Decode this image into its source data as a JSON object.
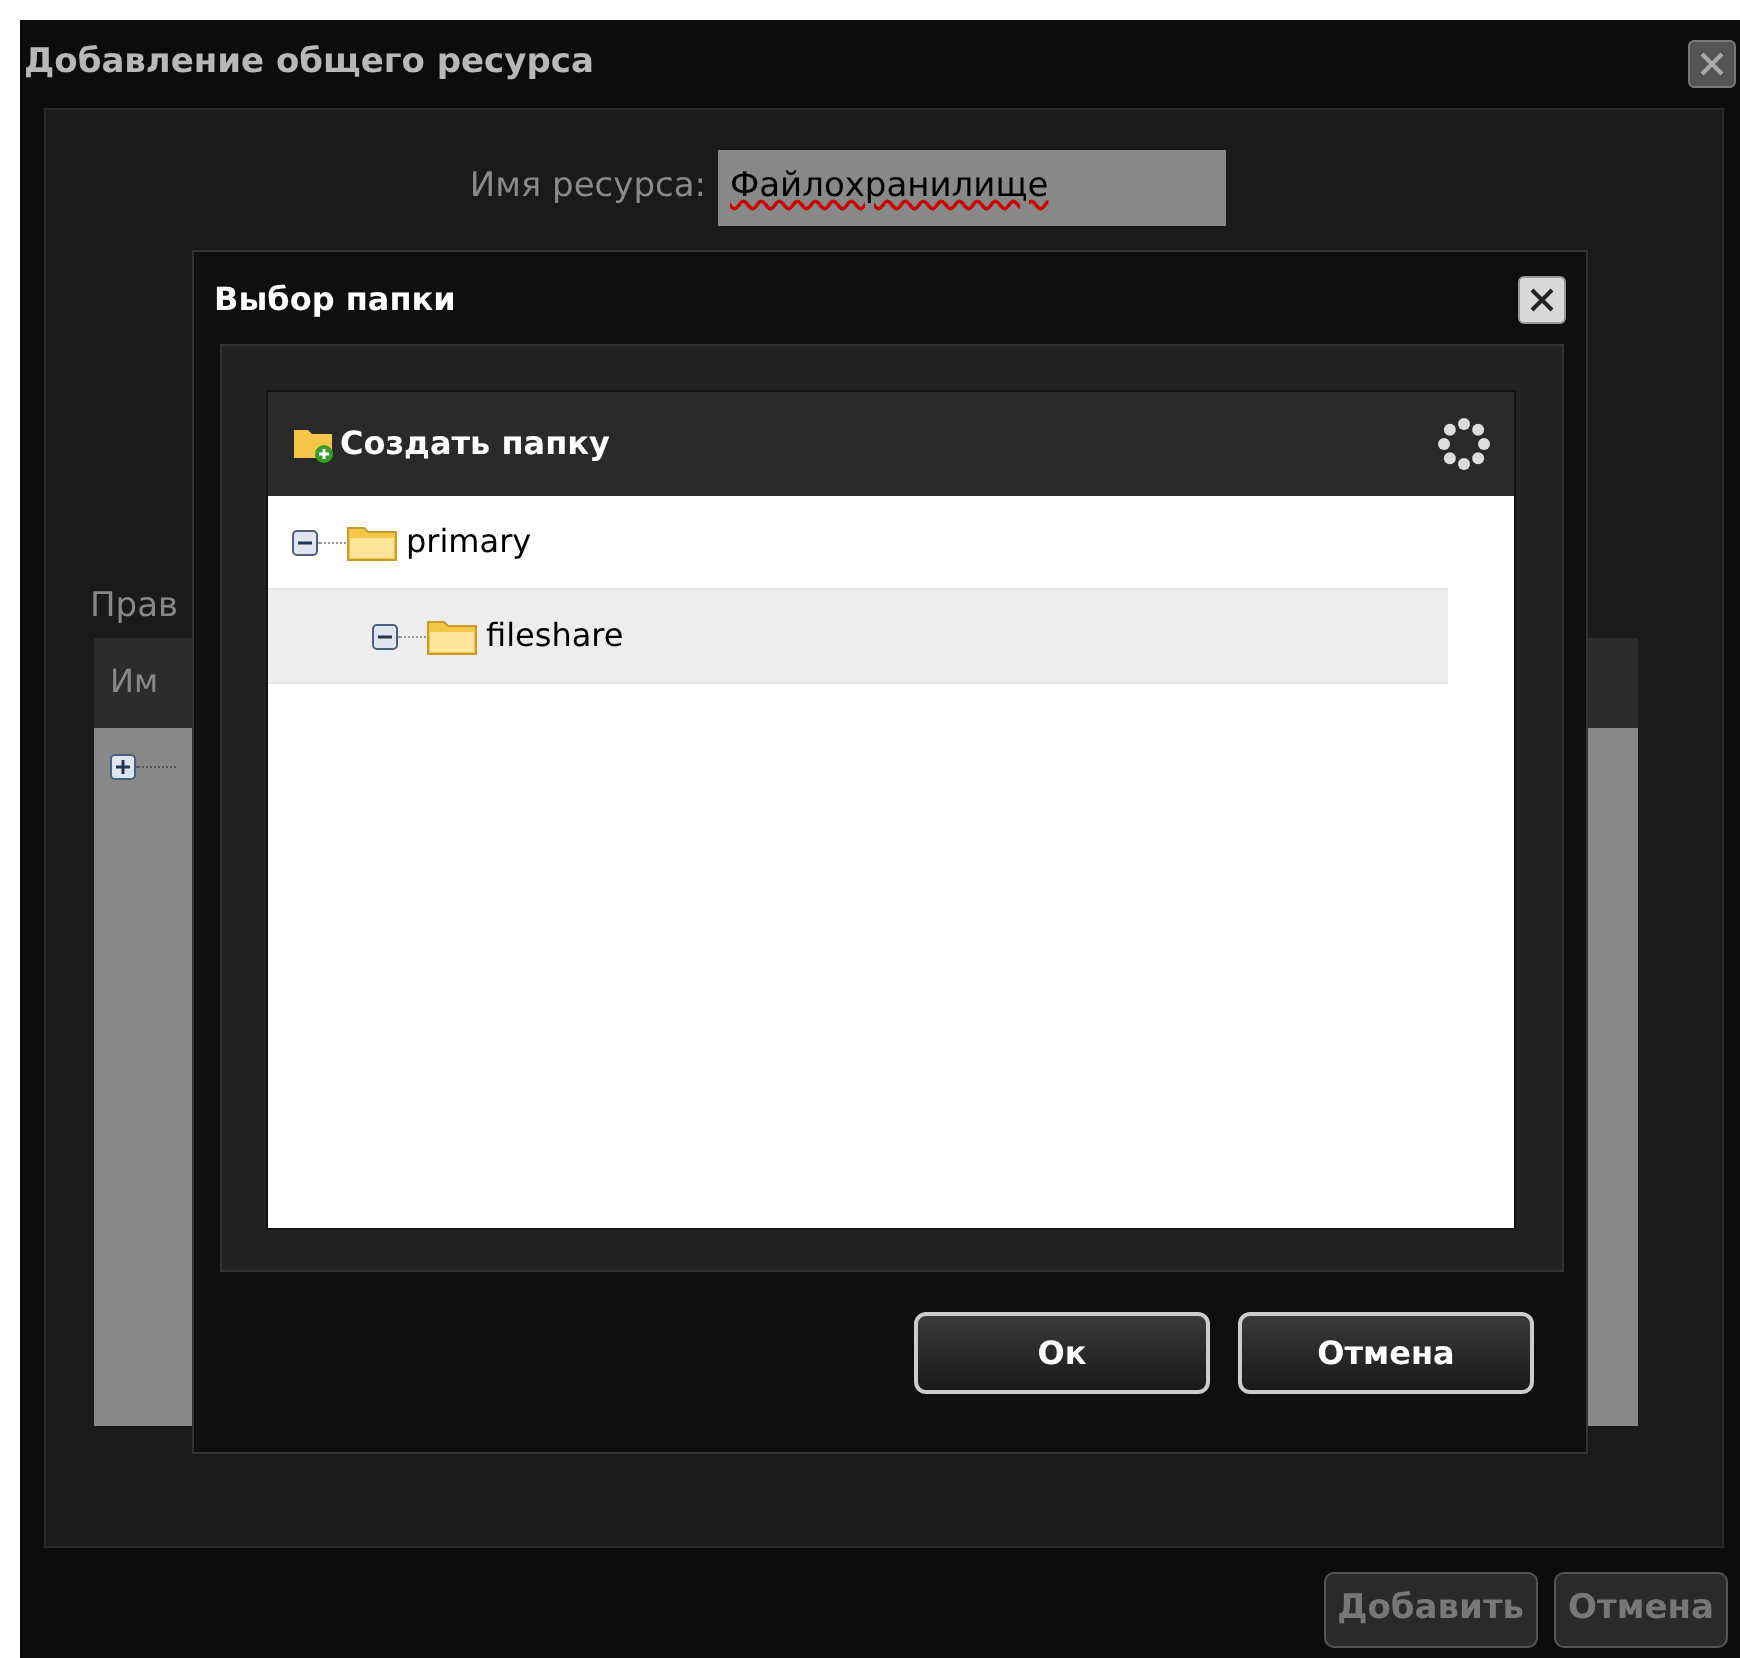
{
  "dialog": {
    "title": "Добавление общего ресурса",
    "fields": [
      {
        "label": "Имя ресурса:",
        "value": "Файлохранилище"
      }
    ],
    "permissions_label": "Прав",
    "table": {
      "columns": [
        "Им"
      ],
      "rows": [
        {
          "expanded": false
        }
      ]
    },
    "buttons": [
      {
        "label": "Добавить",
        "disabled": true
      },
      {
        "label": "Отмена",
        "disabled": true
      }
    ]
  },
  "modal": {
    "title": "Выбор папки",
    "toolbar": {
      "label": "Создать папку"
    },
    "tree": [
      {
        "label": "primary",
        "expanded": true,
        "selected": false,
        "children": [
          {
            "label": "fileshare",
            "expanded": true,
            "selected": true
          }
        ]
      }
    ],
    "buttons": [
      {
        "label": "Ок"
      },
      {
        "label": "Отмена"
      }
    ]
  }
}
